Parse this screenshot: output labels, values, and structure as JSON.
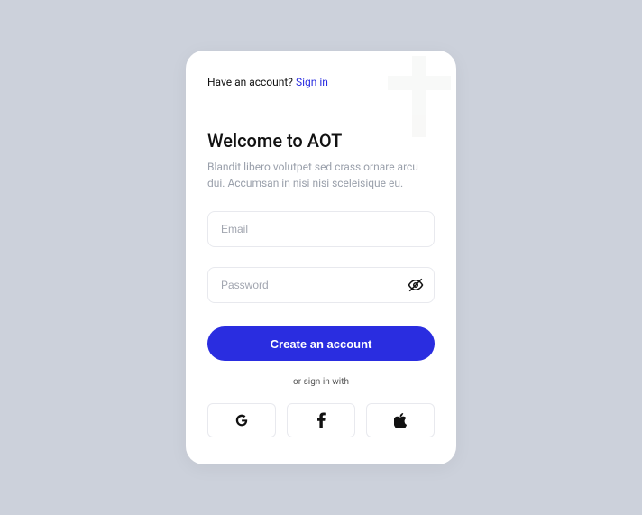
{
  "top": {
    "prompt": "Have an account? ",
    "signin": "Sign in"
  },
  "title": "Welcome to AOT",
  "subtitle": "Blandit libero volutpet sed crass ornare arcu dui. Accumsan in nisi nisi sceleisique eu.",
  "fields": {
    "email_placeholder": "Email",
    "password_placeholder": "Password"
  },
  "submit_label": "Create an account",
  "divider_label": "or sign in with",
  "social": {
    "google": "google-icon",
    "facebook": "facebook-icon",
    "apple": "apple-icon"
  }
}
